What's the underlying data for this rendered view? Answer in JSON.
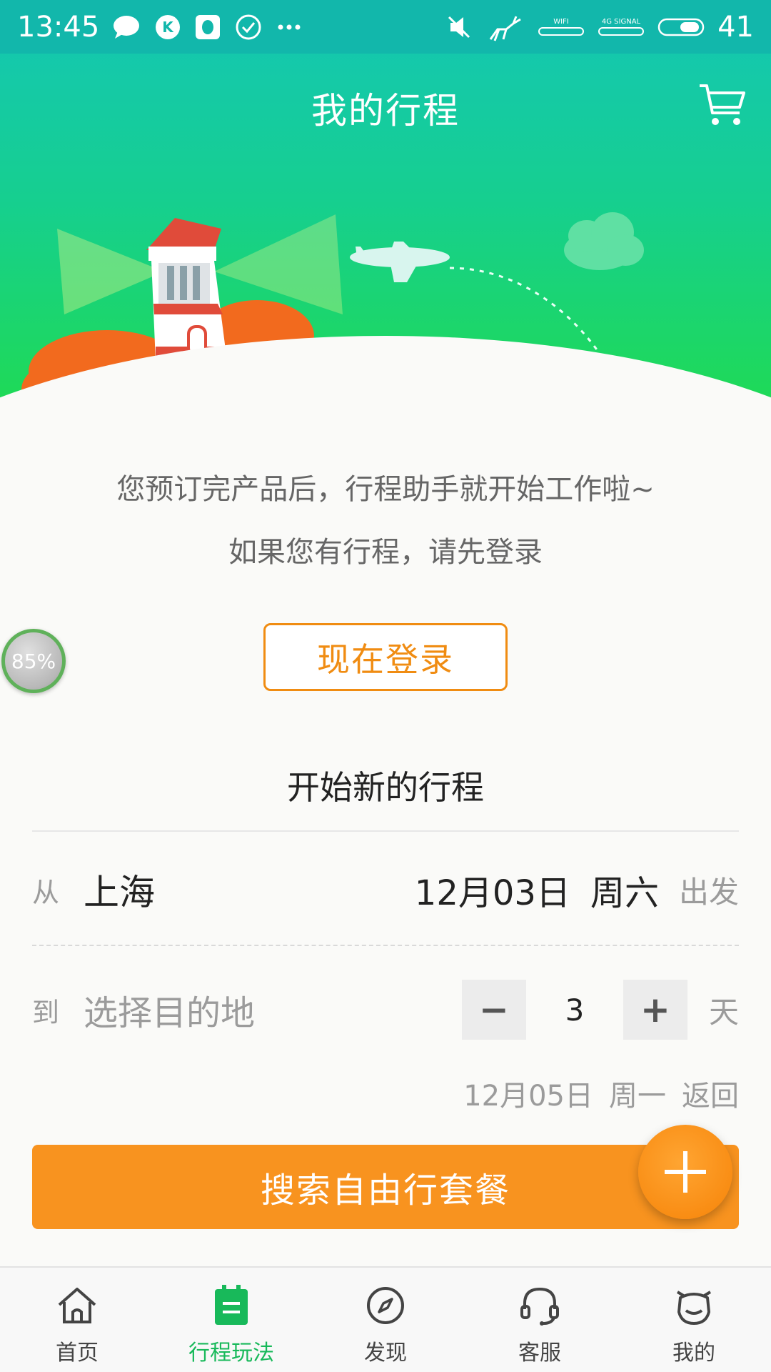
{
  "status_bar": {
    "time": "13:45",
    "battery": "41",
    "left_icons": [
      "chat-bubble-icon",
      "k-app-icon",
      "qq-icon",
      "check-circle-icon",
      "more-icon"
    ],
    "right_icons": [
      "mute-icon",
      "deer-icon",
      "wifi-icon",
      "signal-4g-icon",
      "toggle-icon"
    ],
    "wifi_label": "WIFI",
    "signal_label": "4G SIGNAL"
  },
  "header": {
    "title": "我的行程",
    "cart_icon": "cart-icon",
    "gradient_top": "#14c6b6",
    "gradient_bottom": "#21dc4a"
  },
  "messages": {
    "line1": "您预订完产品后，行程助手就开始工作啦~",
    "line2": "如果您有行程，请先登录"
  },
  "progress_badge": {
    "text": "85%",
    "value": 85
  },
  "login_button": {
    "label": "现在登录",
    "color": "#f08c12"
  },
  "new_trip": {
    "title": "开始新的行程",
    "from_label": "从",
    "from_city": "上海",
    "depart_date": "12月03日",
    "depart_weekday": "周六",
    "depart_suffix": "出发",
    "to_label": "到",
    "to_placeholder": "选择目的地",
    "days": "3",
    "days_unit": "天",
    "minus": "−",
    "plus": "+",
    "return_date": "12月05日",
    "return_weekday": "周一",
    "return_suffix": "返回"
  },
  "search_button": {
    "label": "搜索自由行套餐",
    "color": "#f8931f"
  },
  "fab": {
    "icon": "plus-icon"
  },
  "tabbar": {
    "active_color": "#18b95a",
    "items": [
      {
        "label": "首页",
        "icon": "home-icon"
      },
      {
        "label": "行程玩法",
        "icon": "itinerary-icon"
      },
      {
        "label": "发现",
        "icon": "compass-icon"
      },
      {
        "label": "客服",
        "icon": "headset-icon"
      },
      {
        "label": "我的",
        "icon": "cow-face-icon"
      }
    ]
  }
}
